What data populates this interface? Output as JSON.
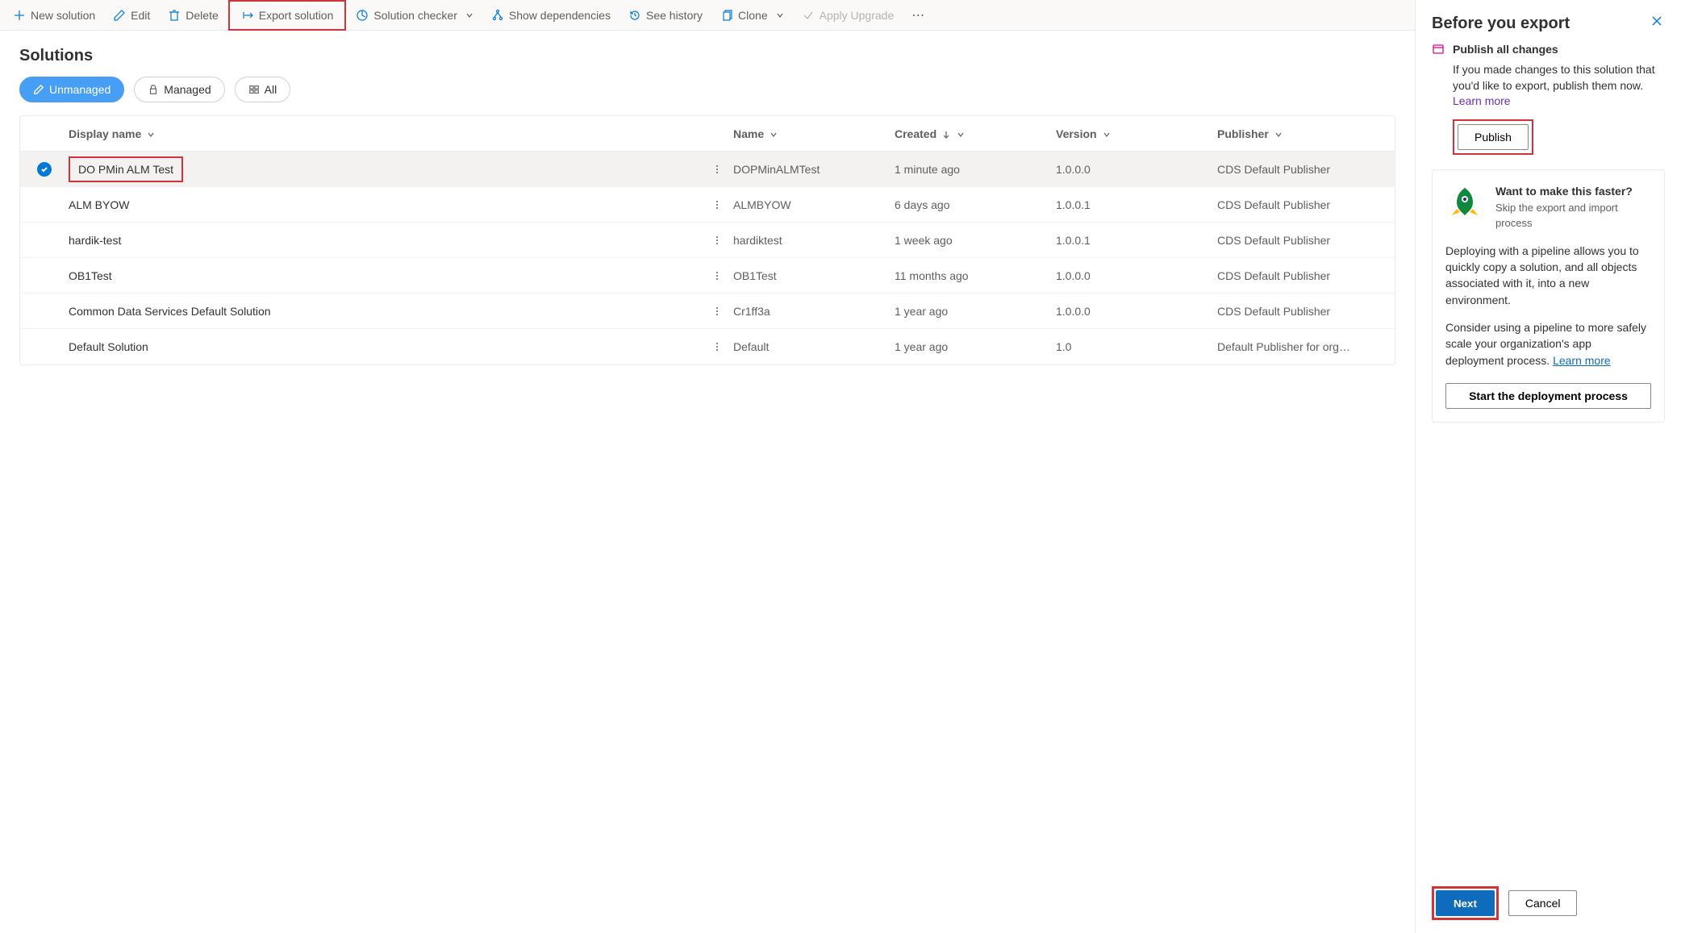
{
  "toolbar": {
    "new": "New solution",
    "edit": "Edit",
    "delete": "Delete",
    "export": "Export solution",
    "check": "Solution checker",
    "deps": "Show dependencies",
    "history": "See history",
    "clone": "Clone",
    "upgrade": "Apply Upgrade"
  },
  "page": {
    "title": "Solutions"
  },
  "filters": {
    "unmanaged": "Unmanaged",
    "managed": "Managed",
    "all": "All"
  },
  "columns": {
    "display": "Display name",
    "name": "Name",
    "created": "Created",
    "version": "Version",
    "publisher": "Publisher"
  },
  "rows": [
    {
      "selected": true,
      "display": "DO PMin ALM Test",
      "name": "DOPMinALMTest",
      "created": "1 minute ago",
      "version": "1.0.0.0",
      "publisher": "CDS Default Publisher"
    },
    {
      "selected": false,
      "display": "ALM BYOW",
      "name": "ALMBYOW",
      "created": "6 days ago",
      "version": "1.0.0.1",
      "publisher": "CDS Default Publisher"
    },
    {
      "selected": false,
      "display": "hardik-test",
      "name": "hardiktest",
      "created": "1 week ago",
      "version": "1.0.0.1",
      "publisher": "CDS Default Publisher"
    },
    {
      "selected": false,
      "display": "OB1Test",
      "name": "OB1Test",
      "created": "11 months ago",
      "version": "1.0.0.0",
      "publisher": "CDS Default Publisher"
    },
    {
      "selected": false,
      "display": "Common Data Services Default Solution",
      "name": "Cr1ff3a",
      "created": "1 year ago",
      "version": "1.0.0.0",
      "publisher": "CDS Default Publisher"
    },
    {
      "selected": false,
      "display": "Default Solution",
      "name": "Default",
      "created": "1 year ago",
      "version": "1.0",
      "publisher": "Default Publisher for org…"
    }
  ],
  "panel": {
    "title": "Before you export",
    "publish_heading": "Publish all changes",
    "publish_body": "If you made changes to this solution that you'd like to export, publish them now. ",
    "learn_more": "Learn more",
    "publish_btn": "Publish",
    "card_title": "Want to make this faster?",
    "card_sub": "Skip the export and import process",
    "card_p1": "Deploying with a pipeline allows you to quickly copy a solution, and all objects associated with it, into a new environment.",
    "card_p2a": "Consider using a pipeline to more safely scale your organization's app deployment process.  ",
    "card_learn": "Learn more",
    "start_btn": "Start the deployment process",
    "next": "Next",
    "cancel": "Cancel"
  }
}
